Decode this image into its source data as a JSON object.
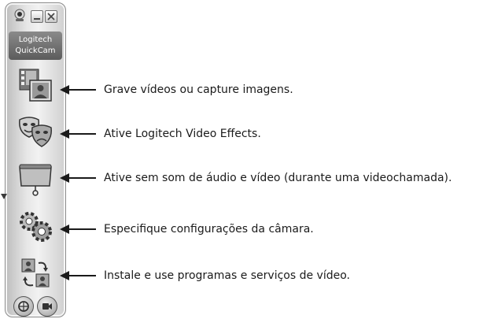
{
  "app": {
    "logo_line1": "Logitech",
    "logo_line2": "QuickCam"
  },
  "toolbar": {
    "buttons": [
      {
        "icon": "record-capture-icon"
      },
      {
        "icon": "video-effects-masks-icon"
      },
      {
        "icon": "mute-privacy-shade-icon"
      },
      {
        "icon": "settings-gears-icon"
      },
      {
        "icon": "video-programs-services-icon"
      }
    ],
    "bottom_buttons": [
      {
        "icon": "help-support-icon"
      },
      {
        "icon": "video-call-camera-icon"
      }
    ]
  },
  "callouts": [
    {
      "text": "Grave vídeos ou capture imagens."
    },
    {
      "text": "Ative Logitech Video Effects."
    },
    {
      "text": "Ative sem som de áudio e vídeo (durante uma videochamada)."
    },
    {
      "text": "Especifique configurações da câmara."
    },
    {
      "text": "Instale e use programas e serviços de vídeo."
    }
  ],
  "colors": {
    "panel": "#e6e6e6",
    "text": "#1a1a1a",
    "logo_bg": "#6e6e6e"
  }
}
